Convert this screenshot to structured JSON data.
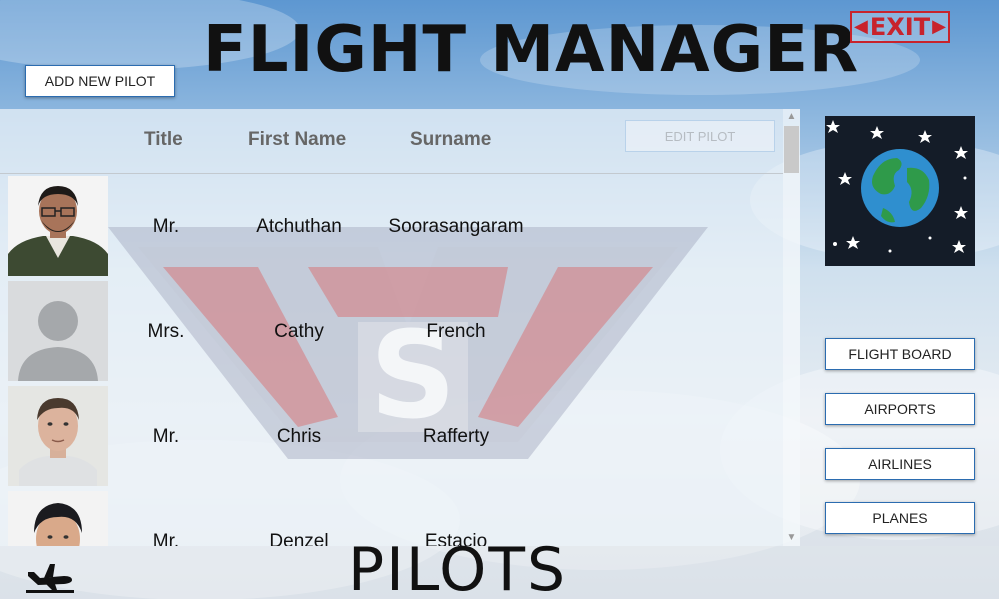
{
  "app_title": "FLIGHT MANAGER",
  "exit": {
    "label": "EXIT",
    "color": "#c8232c"
  },
  "toolbar": {
    "add_pilot_label": "ADD NEW PILOT",
    "edit_pilot_label": "EDIT PILOT"
  },
  "table": {
    "columns": [
      "Title",
      "First Name",
      "Surname"
    ],
    "rows": [
      {
        "title": "Mr.",
        "first_name": "Atchuthan",
        "surname": "Soorasangaram",
        "photo": "photo-man-glasses"
      },
      {
        "title": "Mrs.",
        "first_name": "Cathy",
        "surname": "French",
        "photo": "placeholder-person-icon"
      },
      {
        "title": "Mr.",
        "first_name": "Chris",
        "surname": "Rafferty",
        "photo": "photo-man"
      },
      {
        "title": "Mr.",
        "first_name": "Denzel",
        "surname": "Estacio",
        "photo": "photo-young-man"
      }
    ]
  },
  "nav": {
    "flight_board": "FLIGHT BOARD",
    "airports": "AIRPORTS",
    "airlines": "AIRLINES",
    "planes": "PLANES"
  },
  "page_title": "PILOTS",
  "icons": {
    "exit": "exit-sign-icon",
    "globe": "earth-globe-icon",
    "plane": "plane-departure-icon",
    "placeholder": "placeholder-person-icon"
  },
  "colors": {
    "button_border": "#2b6cb0",
    "panel": "#ecf2f8",
    "watermark_red": "#d64545"
  }
}
